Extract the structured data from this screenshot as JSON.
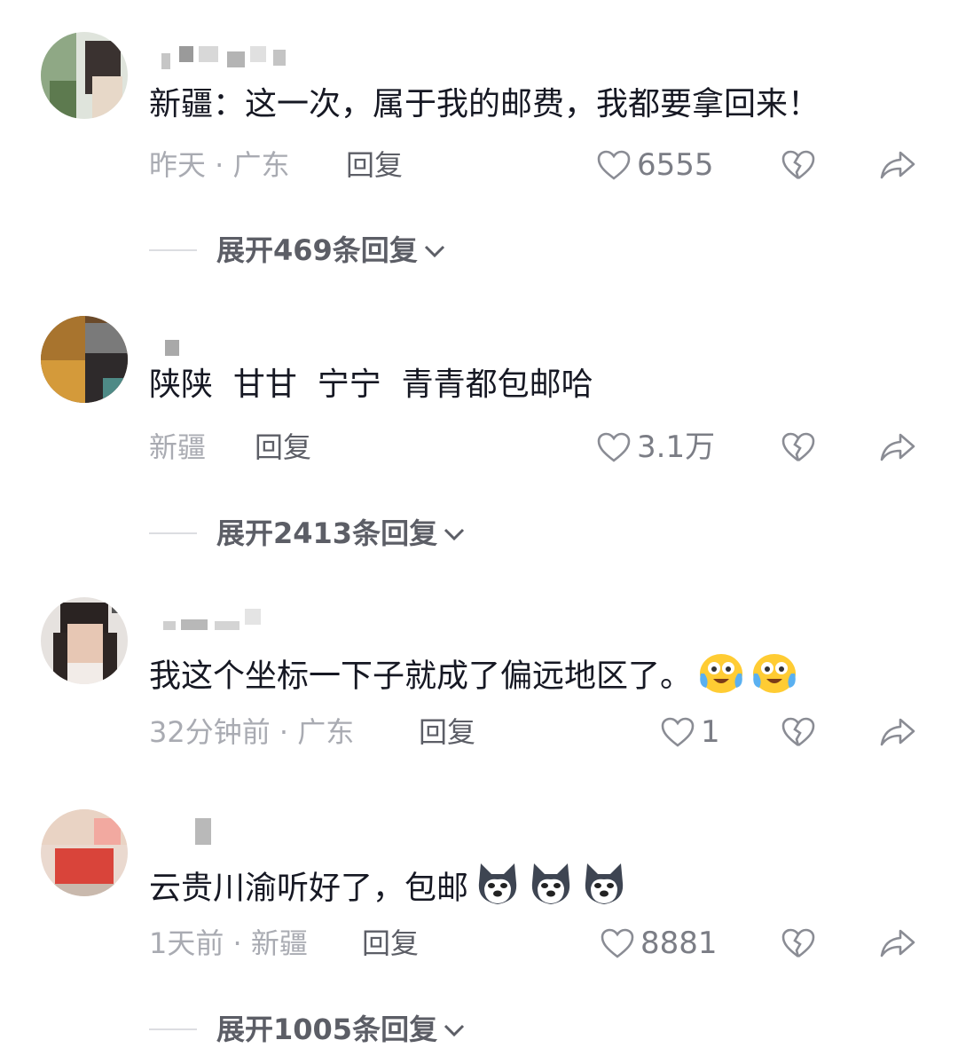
{
  "comments": [
    {
      "text": "新疆：这一次，属于我的邮费，我都要拿回来！",
      "meta": "昨天 · 广东",
      "reply": "回复",
      "likes": "6555",
      "expand": "展开469条回复"
    },
    {
      "text": "陕陕  甘甘  宁宁  青青都包邮哈",
      "meta": "新疆",
      "reply": "回复",
      "likes": "3.1万",
      "expand": "展开2413条回复"
    },
    {
      "text": "我这个坐标一下子就成了偏远地区了。",
      "meta": "32分钟前 · 广东",
      "reply": "回复",
      "likes": "1",
      "emojis": [
        "cry-laugh-emoji",
        "cry-laugh-emoji"
      ]
    },
    {
      "text": "云贵川渝听好了，包邮",
      "meta": "1天前 · 新疆",
      "reply": "回复",
      "likes": "8881",
      "emojis": [
        "husky-emoji",
        "husky-emoji",
        "husky-emoji"
      ],
      "expand": "展开1005条回复"
    }
  ],
  "icons": {
    "like": "heart-outline-icon",
    "dislike": "broken-heart-icon",
    "share": "share-arrow-icon",
    "expand": "chevron-down-icon"
  },
  "colors": {
    "text": "#161823",
    "meta": "#a9abb2",
    "secondary": "#5c5e66"
  }
}
